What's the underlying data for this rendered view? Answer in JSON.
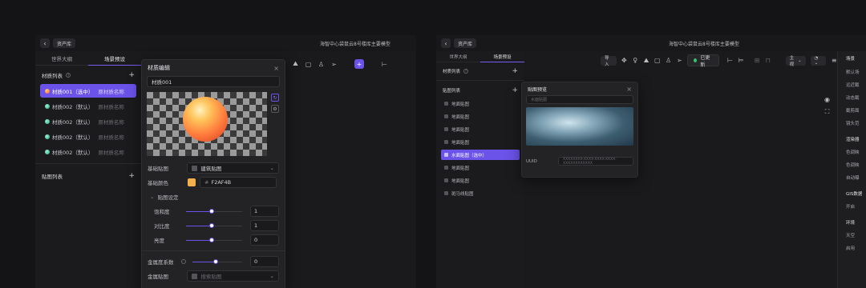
{
  "left": {
    "crumb": "资产库",
    "title": "海智中心袋鼠云8号楼库主要模型",
    "tabs": [
      "世界大纲",
      "场景预设"
    ],
    "materials_header": "材质列表",
    "materials": [
      {
        "name": "材质001（选中）",
        "sub": "原材质名称"
      },
      {
        "name": "材质002（默认）",
        "sub": "原材质名称"
      },
      {
        "name": "材质002（默认）",
        "sub": "原材质名称"
      },
      {
        "name": "材质002（默认）",
        "sub": "原材质名称"
      },
      {
        "name": "材质002（默认）",
        "sub": "原材质名称"
      }
    ],
    "textures_header": "贴图列表",
    "editor": {
      "title": "材质编辑",
      "name_value": "材质001",
      "base_texture_label": "基础贴图",
      "base_texture_value": "建筑贴图",
      "base_color_label": "基础颜色",
      "base_color_hex": "F2AF4B",
      "base_color": "#F2AF4B",
      "texture_settings_label": "贴图设定",
      "sliders": [
        {
          "label": "饱和度",
          "value": "1",
          "level": 0.45
        },
        {
          "label": "对比度",
          "value": "1",
          "level": 0.45
        },
        {
          "label": "亮度",
          "value": "0",
          "level": 0.45
        }
      ],
      "metal_label": "金属度系数",
      "metal_value": "0",
      "metal_level": 0.45,
      "metal_texture_label": "金属贴图",
      "metal_texture_placeholder": "搜索贴图"
    }
  },
  "right": {
    "crumb": "资产库",
    "title": "海智中心袋鼠云8号楼库主要模型",
    "tabs": [
      "世界大纲",
      "场景预设"
    ],
    "materials_header": "材质列表",
    "textures_header": "贴图列表",
    "textures": [
      "地面贴图",
      "地面贴图",
      "地面贴图",
      "地面贴图",
      "水面贴图（选中）",
      "地面贴图",
      "地面贴图",
      "斑马线贴图"
    ],
    "toolbar_import": "导入",
    "status": "已更新",
    "view_mode": "主视",
    "preview": {
      "title": "贴图预览",
      "name_placeholder": "水面贴图",
      "uuid_label": "UUID",
      "uuid_value": "XXXXXXXX-XXXX-XXXX-XXXX-XXXXXXXXXXXX"
    },
    "right_panel": [
      "场景",
      "默认场",
      "远近截",
      "动态截",
      "截剪面",
      "镜头范",
      "渲染器",
      "色调映",
      "色调映",
      "自动曝",
      "GIS数据",
      "开启",
      "环境",
      "天空",
      "启用"
    ]
  }
}
